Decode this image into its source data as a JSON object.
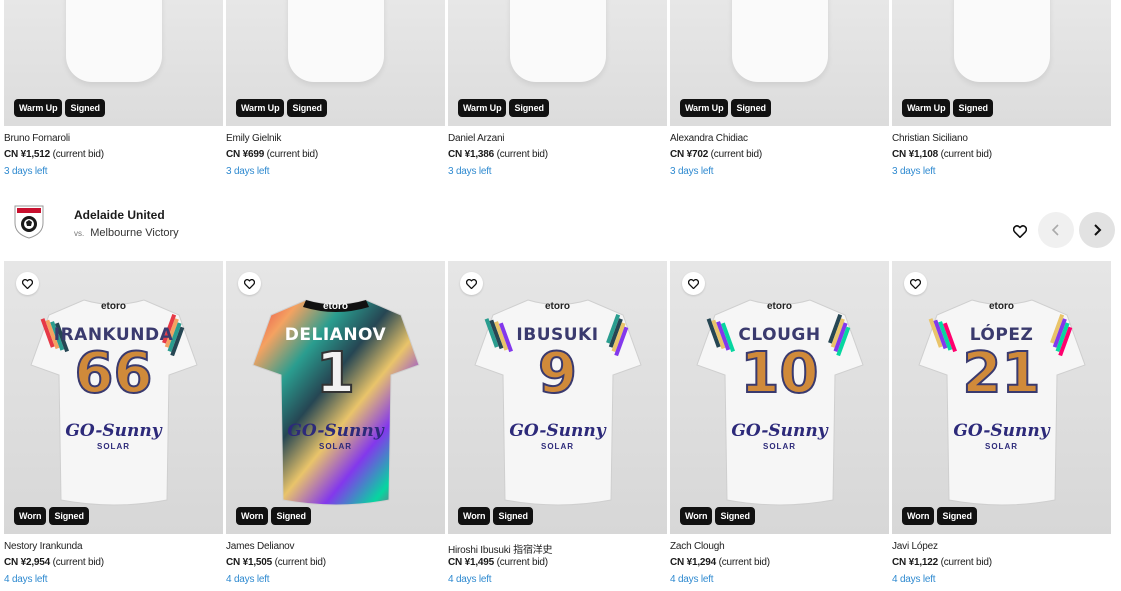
{
  "row1": [
    {
      "tags": [
        "Warm Up",
        "Signed"
      ],
      "name": "Bruno Fornaroli",
      "price": "CN ¥1,512",
      "bid_note": "(current bid)",
      "time_left": "3 days left"
    },
    {
      "tags": [
        "Warm Up",
        "Signed"
      ],
      "name": "Emily Gielnik",
      "price": "CN ¥699",
      "bid_note": "(current bid)",
      "time_left": "3 days left"
    },
    {
      "tags": [
        "Warm Up",
        "Signed"
      ],
      "name": "Daniel Arzani",
      "price": "CN ¥1,386",
      "bid_note": "(current bid)",
      "time_left": "3 days left"
    },
    {
      "tags": [
        "Warm Up",
        "Signed"
      ],
      "name": "Alexandra Chidiac",
      "price": "CN ¥702",
      "bid_note": "(current bid)",
      "time_left": "3 days left"
    },
    {
      "tags": [
        "Warm Up",
        "Signed"
      ],
      "name": "Christian Siciliano",
      "price": "CN ¥1,108",
      "bid_note": "(current bid)",
      "time_left": "3 days left"
    }
  ],
  "match": {
    "team": "Adelaide United",
    "vs_prefix": "vs.",
    "opponent": "Melbourne Victory"
  },
  "row2": [
    {
      "tags": [
        "Worn",
        "Signed"
      ],
      "shirt_name": "IRANKUNDA",
      "number": "66",
      "sponsor": "etoro",
      "sponsor2": "GO-Sunny",
      "sponsor3": "SOLAR",
      "name": "Nestory Irankunda",
      "price": "CN ¥2,954",
      "bid_note": "(current bid)",
      "time_left": "4 days left"
    },
    {
      "tags": [
        "Worn",
        "Signed"
      ],
      "shirt_name": "DELIANOV",
      "number": "1",
      "sponsor": "etoro",
      "sponsor2": "GO-Sunny",
      "sponsor3": "SOLAR",
      "name": "James Delianov",
      "price": "CN ¥1,505",
      "bid_note": "(current bid)",
      "time_left": "4 days left"
    },
    {
      "tags": [
        "Worn",
        "Signed"
      ],
      "shirt_name": "IBUSUKI",
      "number": "9",
      "sponsor": "etoro",
      "sponsor2": "GO-Sunny",
      "sponsor3": "SOLAR",
      "name": "Hiroshi Ibusuki 指宿洋史",
      "price": "CN ¥1,495",
      "bid_note": "(current bid)",
      "time_left": "4 days left"
    },
    {
      "tags": [
        "Worn",
        "Signed"
      ],
      "shirt_name": "CLOUGH",
      "number": "10",
      "sponsor": "etoro",
      "sponsor2": "GO-Sunny",
      "sponsor3": "SOLAR",
      "name": "Zach Clough",
      "price": "CN ¥1,294",
      "bid_note": "(current bid)",
      "time_left": "4 days left"
    },
    {
      "tags": [
        "Worn",
        "Signed"
      ],
      "shirt_name": "LÓPEZ",
      "number": "21",
      "sponsor": "etoro",
      "sponsor2": "GO-Sunny",
      "sponsor3": "SOLAR",
      "name": "Javi López",
      "price": "CN ¥1,122",
      "bid_note": "(current bid)",
      "time_left": "4 days left"
    }
  ],
  "icons": {
    "favorite": "heart-icon",
    "prev": "chevron-left-icon",
    "next": "chevron-right-icon",
    "crest": "adelaide-united-crest-icon"
  },
  "colors": {
    "link": "#2f8ad0",
    "tag_bg": "#111111",
    "shirt_text": "#3a3a6e"
  }
}
